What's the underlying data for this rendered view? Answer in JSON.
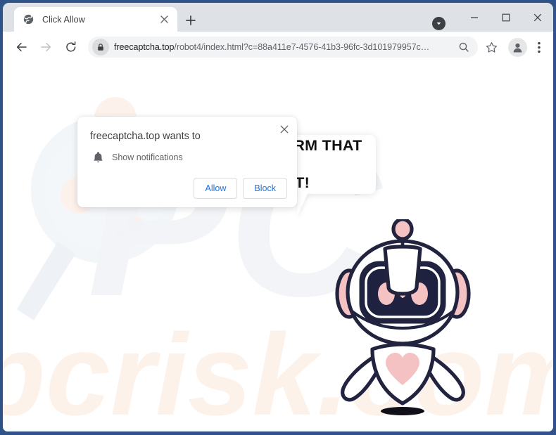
{
  "window": {
    "controls": {
      "minimize_label": "Minimize",
      "maximize_label": "Maximize",
      "close_label": "Close"
    },
    "border_color": "#2f5288",
    "tabstrip_color": "#dee1e6"
  },
  "tab": {
    "title": "Click Allow",
    "favicon_name": "globe-favicon",
    "close_label": "Close tab",
    "new_tab_label": "New tab"
  },
  "toolbar": {
    "back_label": "Back",
    "forward_label": "Forward",
    "reload_label": "Reload",
    "url_host": "freecaptcha.top",
    "url_path": "/robot4/index.html?c=88a411e7-4576-41b3-96fc-3d101979957c…",
    "url_full": "freecaptcha.top/robot4/index.html?c=88a411e7-4576-41b3-96fc-3d101979957c…",
    "lock_icon_name": "lock-icon",
    "zoom_icon_name": "search-zoom-icon",
    "bookmark_label": "Bookmark this tab",
    "profile_label": "Profile",
    "menu_label": "Customize and control Google Chrome"
  },
  "dialog": {
    "title": "freecaptcha.top wants to",
    "permission": "Show notifications",
    "bell_icon_name": "bell-icon",
    "allow_label": "Allow",
    "block_label": "Block",
    "close_label": "Close",
    "link_color": "#1a73e8",
    "border_color": "#dadce0"
  },
  "page": {
    "bubble_line1": "CLICK ALLOW TO CONFIRM THAT YOU",
    "bubble_line2": "ARE NOT A ROBOT!",
    "robot_name": "robot-mascot",
    "colors": {
      "outline": "#22243f",
      "accent_pink": "#f4c2c2",
      "visor": "#1f2140",
      "background": "#ffffff"
    },
    "watermark_text": "pcrisk.com",
    "watermark_color": "#fdf1ea"
  }
}
